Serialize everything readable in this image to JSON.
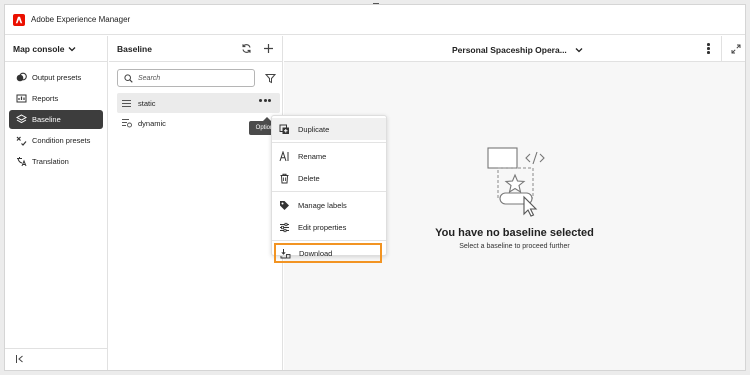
{
  "app": {
    "title": "Adobe Experience Manager"
  },
  "left_nav": {
    "console_label": "Map console",
    "items": [
      {
        "label": "Output presets",
        "icon": "output-presets-icon",
        "active": false
      },
      {
        "label": "Reports",
        "icon": "reports-icon",
        "active": false
      },
      {
        "label": "Baseline",
        "icon": "baseline-icon",
        "active": true
      },
      {
        "label": "Condition presets",
        "icon": "condition-presets-icon",
        "active": false
      },
      {
        "label": "Translation",
        "icon": "translation-icon",
        "active": false
      }
    ]
  },
  "baseline_panel": {
    "title": "Baseline",
    "search_placeholder": "Search",
    "items": [
      {
        "label": "static",
        "icon": "baseline-static-icon"
      },
      {
        "label": "dynamic",
        "icon": "baseline-dynamic-icon"
      }
    ],
    "tooltip": "Options"
  },
  "context_menu": {
    "items": [
      {
        "label": "Duplicate",
        "icon": "duplicate-icon"
      },
      {
        "label": "Rename",
        "icon": "rename-icon"
      },
      {
        "label": "Delete",
        "icon": "delete-icon"
      },
      {
        "label": "Manage labels",
        "icon": "label-icon"
      },
      {
        "label": "Edit properties",
        "icon": "properties-icon"
      },
      {
        "label": "Download",
        "icon": "download-icon",
        "highlighted": true
      }
    ]
  },
  "main": {
    "map_title": "Personal Spaceship Opera...",
    "empty_title": "You have no baseline selected",
    "empty_subtitle": "Select a baseline to proceed further"
  },
  "colors": {
    "brand": "#eb1000",
    "active_nav": "#3d3d3d",
    "highlight_outline": "#f29423"
  }
}
